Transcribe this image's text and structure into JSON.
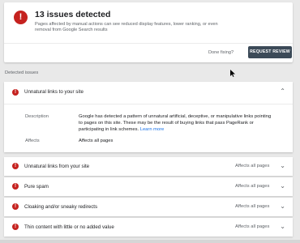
{
  "summary": {
    "icon": "error-icon",
    "title": "13 issues detected",
    "description": "Pages affected by manual actions can see reduced display features, lower ranking, or even removal from Google Search results",
    "done_fixing_label": "Done fixing?",
    "request_review_label": "REQUEST REVIEW"
  },
  "detected_label": "Detected issues",
  "expanded_issue": {
    "title": "Unnatural links to your site",
    "chevron": "chevron-up-icon",
    "description_label": "Description",
    "description_text": "Google has detected a pattern of unnatural artificial, deceptive, or manipulative links pointing to pages on this site. These may be the result of buying links that pass PageRank or participating in link schemes.",
    "learn_more": "Learn more",
    "affects_label": "Affects",
    "affects_value": "Affects all pages"
  },
  "issues": [
    {
      "title": "Unnatural links from your site",
      "affects": "Affects all pages"
    },
    {
      "title": "Pure spam",
      "affects": "Affects all pages"
    },
    {
      "title": "Cloaking and/or sneaky redirects",
      "affects": "Affects all pages"
    },
    {
      "title": "Thin content with little or no added value",
      "affects": "Affects all pages"
    }
  ],
  "colors": {
    "error": "#c5221f",
    "button": "#3c4a58",
    "link": "#1a73e8",
    "background": "#e9e9e9"
  }
}
